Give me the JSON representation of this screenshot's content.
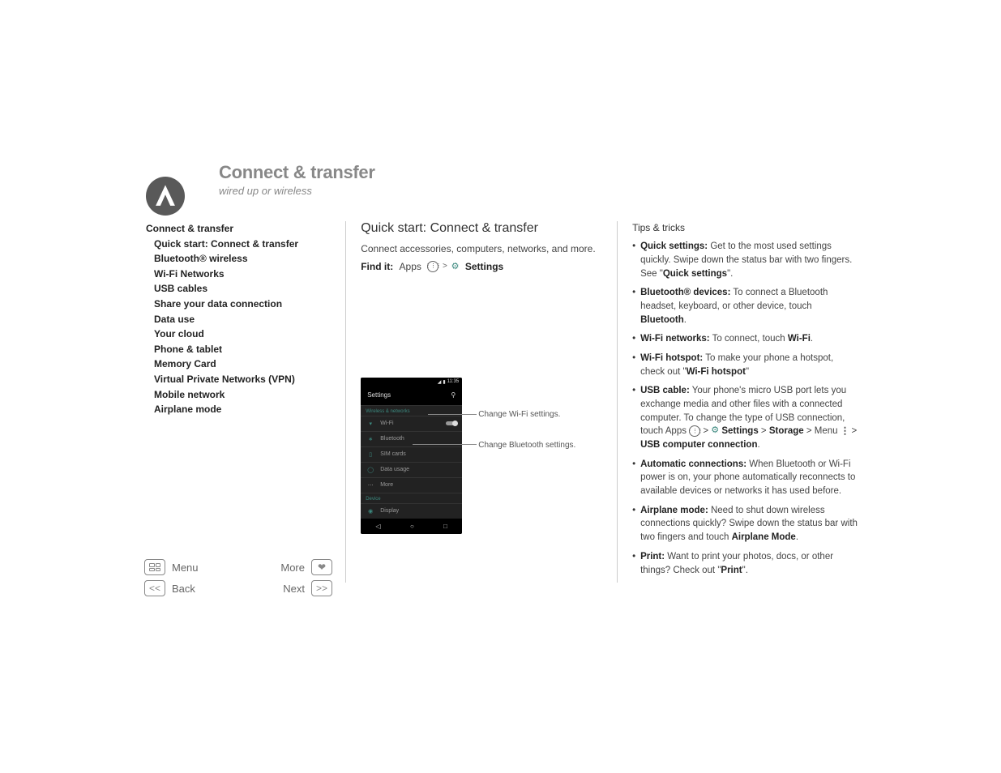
{
  "header": {
    "title": "Connect & transfer",
    "subtitle": "wired up or wireless"
  },
  "sidebar": {
    "heading": "Connect & transfer",
    "items": [
      "Quick start: Connect & transfer",
      "Bluetooth® wireless",
      "Wi-Fi Networks",
      "USB cables",
      "Share your data connection",
      "Data use",
      "Your cloud",
      "Phone & tablet",
      "Memory Card",
      "Virtual Private Networks (VPN)",
      "Mobile network",
      "Airplane mode"
    ]
  },
  "main": {
    "h": "Quick start: Connect & transfer",
    "desc": "Connect accessories, computers, networks, and more.",
    "findit_label": "Find it:",
    "findit_apps": "Apps",
    "findit_settings": "Settings"
  },
  "phone": {
    "time": "11:35",
    "title": "Settings",
    "sect1": "Wireless & networks",
    "rows1": [
      "Wi-Fi",
      "Bluetooth",
      "SIM cards",
      "Data usage",
      "More"
    ],
    "sect2": "Device",
    "rows2": [
      "Display"
    ],
    "callout1": "Change Wi-Fi settings.",
    "callout2": "Change Bluetooth settings."
  },
  "tips": {
    "h": "Tips & tricks",
    "items": [
      {
        "b": "Quick settings:",
        "t1": " Get to the most used settings quickly. Swipe down the status bar with two fingers. See \"",
        "b2": "Quick settings",
        "t2": "\"."
      },
      {
        "b": "Bluetooth® devices:",
        "t1": " To connect a Bluetooth headset, keyboard, or other device, touch ",
        "b2": "Bluetooth",
        "t2": "."
      },
      {
        "b": "Wi-Fi networks:",
        "t1": " To connect, touch ",
        "b2": "Wi-Fi",
        "t2": "."
      },
      {
        "b": "Wi-Fi hotspot:",
        "t1": " To make your phone a hotspot, check out \"",
        "b2": "Wi-Fi hotspot",
        "t2": "\""
      },
      {
        "b": "USB cable:",
        "t1": " Your phone's micro USB port lets you exchange media and other files with a connected computer. To change the type of USB connection, touch Apps ",
        "path": true,
        "path_t": " > Settings > Storage > Menu ⋮ > USB computer connection",
        "t2": "."
      },
      {
        "b": "Automatic connections:",
        "t1": " When Bluetooth or Wi-Fi power is on, your phone automatically reconnects to available devices or networks it has used before.",
        "b2": "",
        "t2": ""
      },
      {
        "b": "Airplane mode:",
        "t1": " Need to shut down wireless connections quickly? Swipe down the status bar with two fingers and touch ",
        "b2": "Airplane Mode",
        "t2": "."
      },
      {
        "b": "Print:",
        "t1": " Want to print your photos, docs, or other things? Check out \"",
        "b2": "Print",
        "t2": "\"."
      }
    ]
  },
  "nav": {
    "menu": "Menu",
    "more": "More",
    "back": "Back",
    "next": "Next"
  }
}
